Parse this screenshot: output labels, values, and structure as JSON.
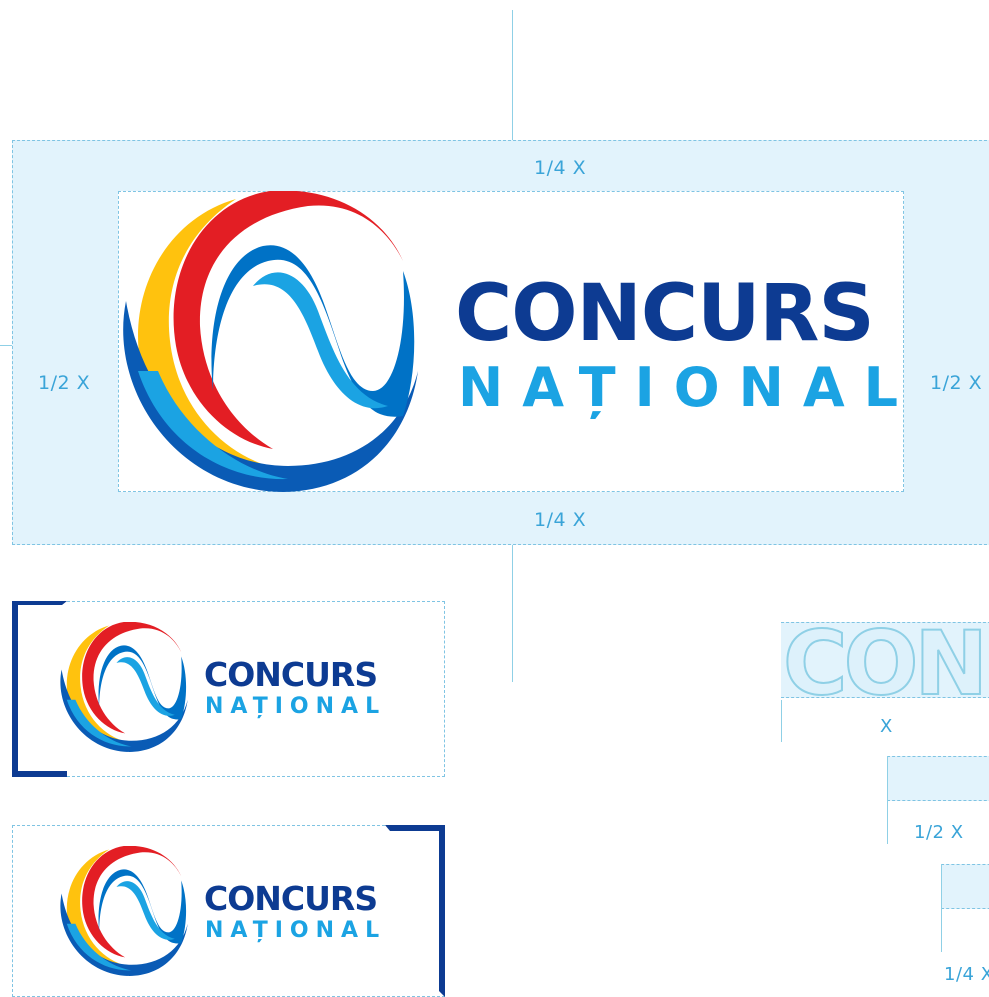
{
  "brand": {
    "line1": "CONCURS",
    "line2": "NAȚIONAL",
    "colors": {
      "navy": "#0d3b92",
      "cyan": "#1ba3e3",
      "red": "#e31e24",
      "yellow": "#ffc20e",
      "blue": "#0072c6",
      "guide": "#8fd0e6",
      "guide_fill": "#e2f3fc"
    }
  },
  "main_guide": {
    "top_margin": "1/4 X",
    "bottom_margin": "1/4 X",
    "left_margin": "1/2 X",
    "right_margin": "1/2 X"
  },
  "construction": {
    "outline_word": "CON",
    "width_label": "X",
    "half_label": "1/2 X",
    "quarter_label": "1/4 X"
  },
  "icons": [
    "swirl-logo-icon",
    "corner-mark-icon"
  ]
}
